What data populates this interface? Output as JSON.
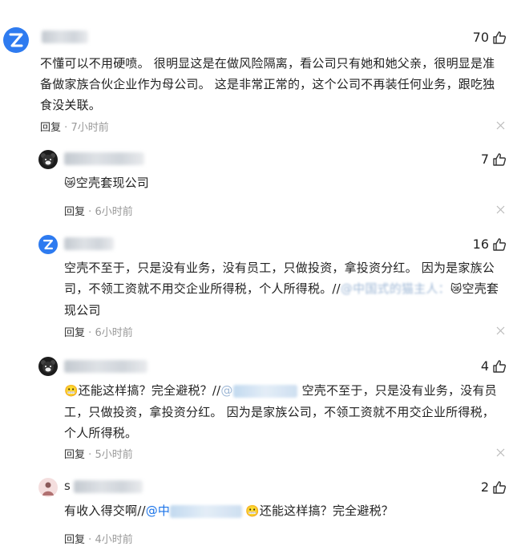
{
  "comments": [
    {
      "likes": "70",
      "text": "不懂可以不用硬喷。 很明显这是在做风险隔离，看公司只有她和她父亲，很明显是准备做家族合伙企业作为母公司。 这是非常正常的，这个公司不再装任何业务，跟吃独食没关联。",
      "reply_label": "回复",
      "sep": "·",
      "time": "7小时前"
    },
    {
      "likes": "7",
      "emoji": "😿",
      "text": "空壳套现公司",
      "reply_label": "回复",
      "sep": "·",
      "time": "6小时前"
    },
    {
      "likes": "16",
      "text": "空壳不至于，只是没有业务，没有员工，只做投资，拿投资分红。 因为是家族公司，不领工资就不用交企业所得税，个人所得税。//",
      "mention": "@中国式的猫主人：",
      "emoji": "😿",
      "quote": "空壳套现公司",
      "reply_label": "回复",
      "sep": "·",
      "time": "6小时前"
    },
    {
      "likes": "4",
      "emoji": "😬",
      "text": "还能这样搞？完全避税？//",
      "mention": "@",
      "quote": "空壳不至于，只是没有业务，没有员工，只做投资，拿投资分红。 因为是家族公司，不领工资就不用交企业所得税，个人所得税。",
      "reply_label": "回复",
      "sep": "·",
      "time": "5小时前"
    },
    {
      "name_initial": "s",
      "likes": "2",
      "text": "有收入得交啊//",
      "mention": "@中",
      "emoji": "😬",
      "quote": "还能这样搞？完全避税？",
      "reply_label": "回复",
      "sep": "·",
      "time": "4小时前"
    }
  ],
  "icons": {
    "like": "thumbs-up-icon",
    "close": "close-icon",
    "avatar_z": "z-logo-avatar"
  },
  "colors": {
    "avatar_blue": "#2e7bf0",
    "mention_blue": "#1a73e8",
    "meta_gray": "#999999"
  }
}
